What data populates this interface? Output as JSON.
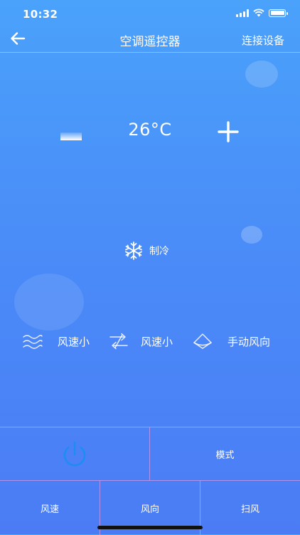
{
  "status_bar": {
    "time": "10:32"
  },
  "navbar": {
    "title": "空调遥控器",
    "connect_label": "连接设备"
  },
  "temperature": {
    "display": "26°C"
  },
  "mode": {
    "label": "制冷",
    "icon": "snowflake-icon"
  },
  "controls": [
    {
      "label": "风速小",
      "icon": "wind-waves-icon"
    },
    {
      "label": "风速小",
      "icon": "wind-direction-arrows-icon"
    },
    {
      "label": "手动风向",
      "icon": "fan-sweep-icon"
    }
  ],
  "buttons": {
    "power_icon": "power-icon",
    "mode_label": "模式",
    "fan_speed_label": "风速",
    "direction_label": "风向",
    "sweep_label": "扫风"
  },
  "colors": {
    "background_top": "#4aa2fb",
    "background_bottom": "#4b7cf5",
    "power_icon": "#1e8cf5",
    "grid_line": "#be96eb"
  }
}
